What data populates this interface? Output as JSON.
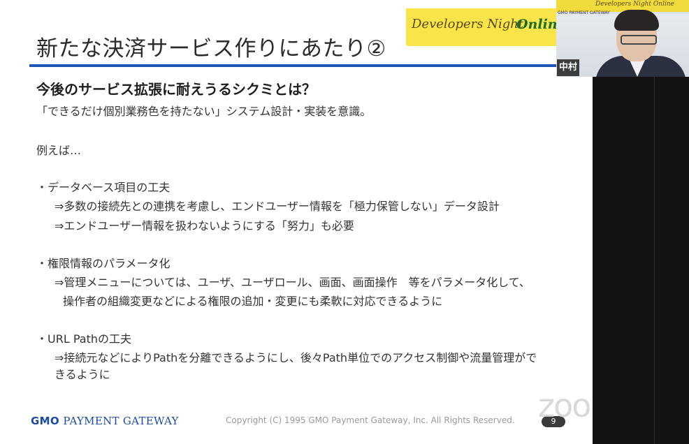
{
  "slide": {
    "title": "新たな決済サービス作りにあたり②",
    "subheading": "今後のサービス拡張に耐えうるシクミとは？",
    "lines": [
      "「できるだけ個別業務色を持たない」システム設計・実装を意識。",
      "例えば…",
      "・データベース項目の工夫",
      "⇒多数の接続先との連携を考慮し、エンドユーザー情報を「極力保管しない」データ設計",
      "⇒エンドユーザー情報を扱わないようにする「努力」も必要",
      "・権限情報のパラメータ化",
      "⇒管理メニューについては、ユーザ、ユーザロール、画面、画面操作　等をパラメータ化して、",
      "操作者の組織変更などによる権限の追加・変更にも柔軟に対応できるように",
      "・URL Pathの工夫",
      "⇒接続元などによりPathを分離できるようにし、後々Path単位でのアクセス制御や流量管理ができるように"
    ],
    "line_last_wrap": [
      "⇒接続元などによりPathを分離できるようにし、後々Path単位でのアクセス制御や流量管理がで",
      "きるように"
    ]
  },
  "banner": {
    "developers": "Developers Night",
    "online": "Online"
  },
  "footer": {
    "logo_gmo": "GMO",
    "logo_rest": "PAYMENT GATEWAY",
    "copyright": "Copyright (C) 1995 GMO Payment Gateway, Inc. All Rights Reserved.",
    "page": "9"
  },
  "zoom": {
    "watermark": "zoom"
  },
  "video": {
    "banner_text": "Developers Night Online",
    "logo_text": "GMO PAYMENT GATEWAY",
    "participant_name": "中村"
  }
}
